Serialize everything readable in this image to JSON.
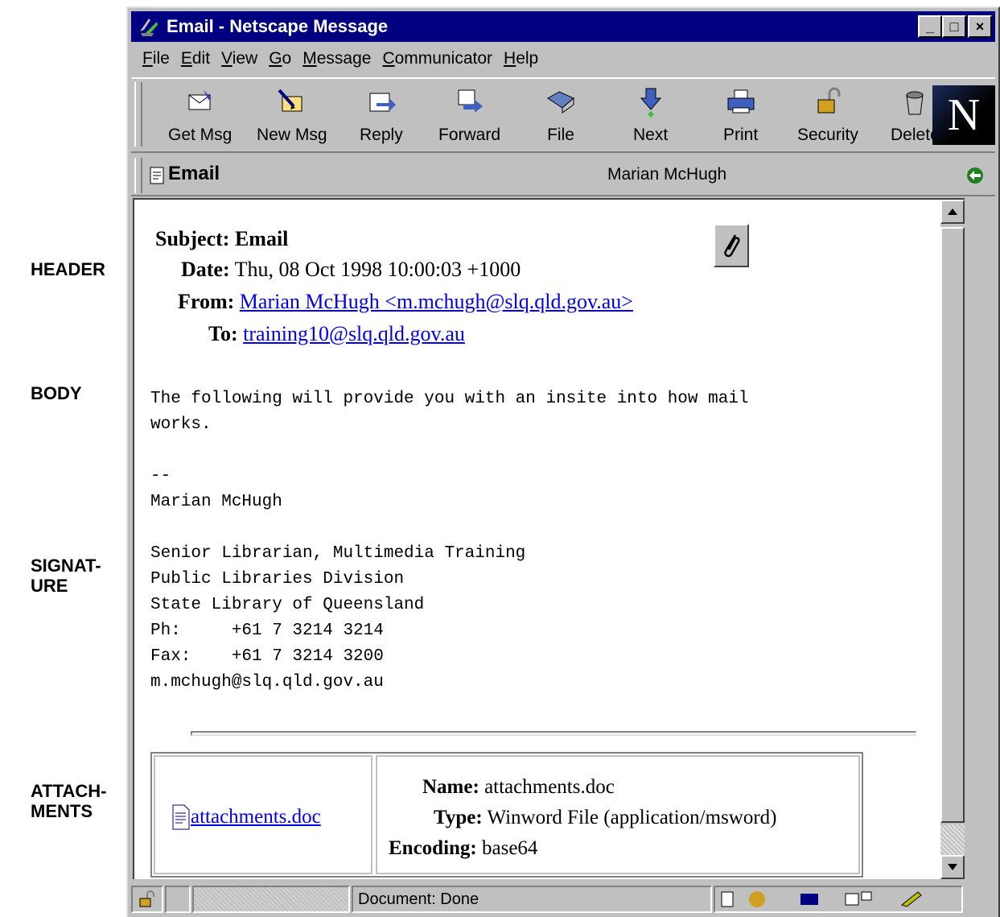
{
  "side_labels": {
    "header": "HEADER",
    "body": "BODY",
    "signature_line1": "SIGNAT-",
    "signature_line2": "URE",
    "attachments_line1": "ATTACH-",
    "attachments_line2": "MENTS"
  },
  "window": {
    "title": "Email - Netscape Message",
    "controls": {
      "minimize": "_",
      "maximize": "□",
      "close": "×"
    }
  },
  "menu": [
    {
      "underline": "F",
      "rest": "ile"
    },
    {
      "underline": "E",
      "rest": "dit"
    },
    {
      "underline": "V",
      "rest": "iew"
    },
    {
      "underline": "G",
      "rest": "o"
    },
    {
      "underline": "M",
      "rest": "essage"
    },
    {
      "underline": "C",
      "rest": "ommunicator"
    },
    {
      "underline": "H",
      "rest": "elp"
    }
  ],
  "toolbar": {
    "get_msg": "Get Msg",
    "new_msg": "New Msg",
    "reply": "Reply",
    "forward": "Forward",
    "file": "File",
    "next": "Next",
    "print": "Print",
    "security": "Security",
    "delete": "Delete",
    "logo": "N"
  },
  "location": {
    "title": "Email",
    "sender": "Marian McHugh"
  },
  "message": {
    "subject_label": "Subject:",
    "subject": "Email",
    "date_label": "Date:",
    "date": "Thu, 08 Oct 1998 10:00:03 +1000",
    "from_label": "From:",
    "from": "Marian McHugh <m.mchugh@slq.qld.gov.au>",
    "to_label": "To:",
    "to": "training10@slq.qld.gov.au",
    "body_line1": "The following will provide you with an insite into how mail",
    "body_line2": "works.",
    "sig_sep": "--",
    "sig_name": "Marian McHugh",
    "sig_line1": "Senior Librarian, Multimedia Training",
    "sig_line2": "Public Libraries Division",
    "sig_line3": "State Library of Queensland",
    "sig_phone": "Ph:     +61 7 3214 3214",
    "sig_fax": "Fax:    +61 7 3214 3200",
    "sig_email": "m.mchugh@slq.qld.gov.au"
  },
  "attachment": {
    "link": "attachments.doc",
    "name_label": "Name:",
    "name": "attachments.doc",
    "type_label": "Type:",
    "type": "Winword File (application/msword)",
    "encoding_label": "Encoding:",
    "encoding": "base64"
  },
  "status": {
    "text": "Document: Done"
  },
  "colors": {
    "titlebar": "#000080",
    "chrome": "#c0c0c0",
    "link": "#0000ee"
  }
}
